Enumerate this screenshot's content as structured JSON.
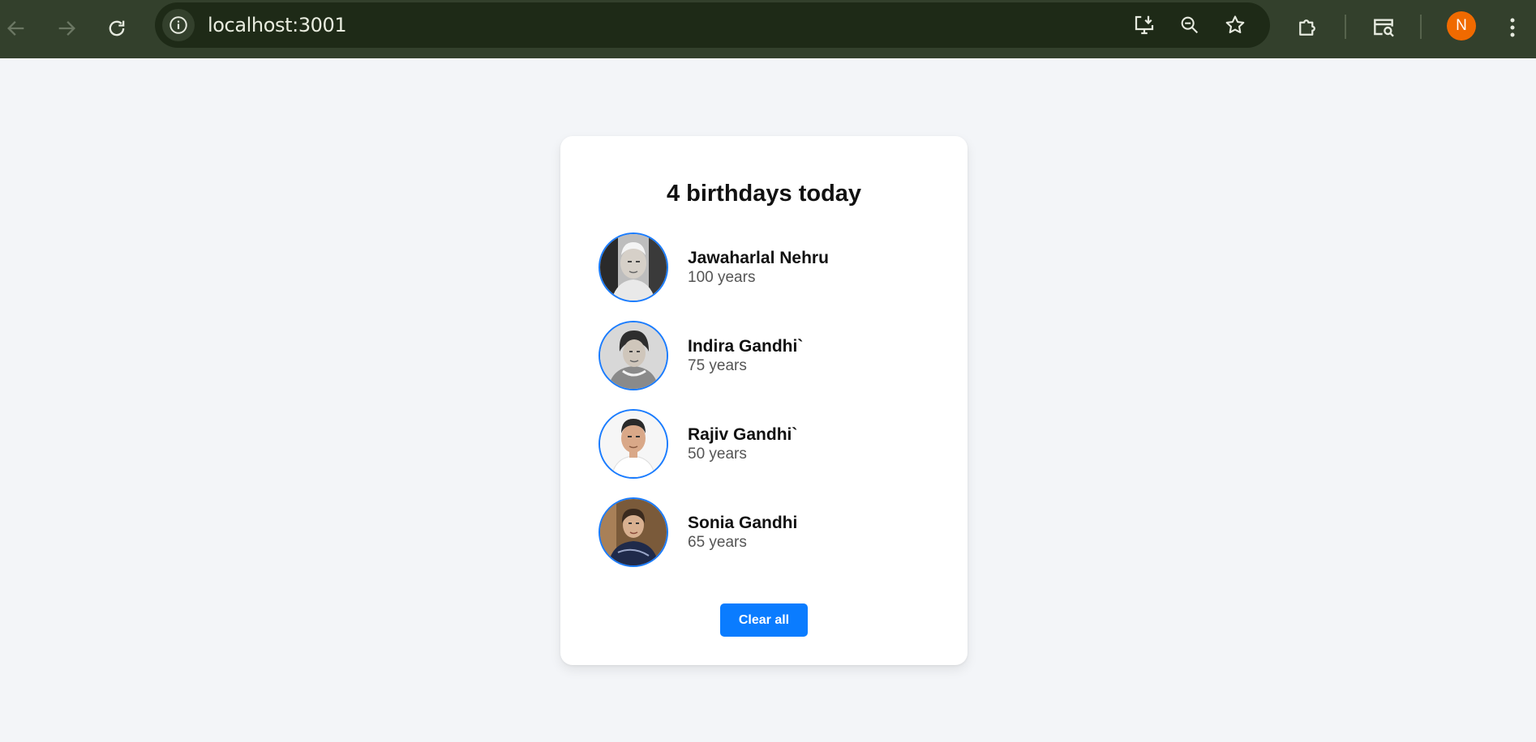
{
  "browser": {
    "url": "localhost:3001",
    "profile_initial": "N",
    "icons": {
      "back": "back-arrow-icon",
      "forward": "forward-arrow-icon",
      "reload": "reload-icon",
      "site_info": "info-icon",
      "install": "install-app-icon",
      "zoom": "zoom-out-icon",
      "bookmark": "star-icon",
      "extensions": "puzzle-icon",
      "search_tabs": "tab-search-icon",
      "menu": "kebab-menu-icon"
    },
    "colors": {
      "toolbar": "#33402c",
      "omnibox": "#1e2a17",
      "avatar": "#f06a00"
    }
  },
  "page": {
    "title": "4 birthdays today",
    "people": [
      {
        "name": "Jawaharlal Nehru",
        "age": "100 years"
      },
      {
        "name": "Indira Gandhi`",
        "age": "75 years"
      },
      {
        "name": "Rajiv Gandhi`",
        "age": "50 years"
      },
      {
        "name": "Sonia Gandhi",
        "age": "65 years"
      }
    ],
    "clear_button": "Clear all",
    "colors": {
      "background": "#f3f5f8",
      "accent": "#0a7cff"
    }
  }
}
